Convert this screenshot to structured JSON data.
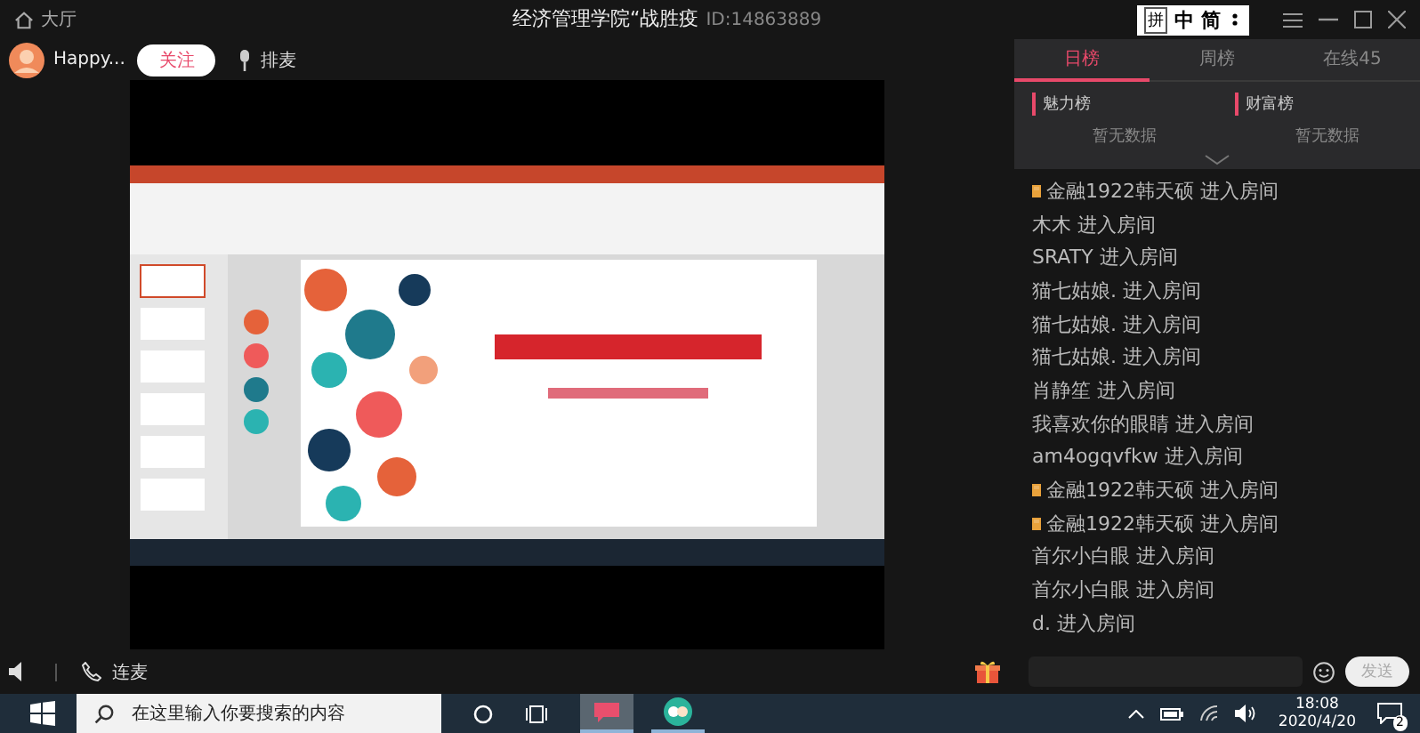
{
  "header": {
    "back_label": "大厅",
    "title": "经济管理学院“战胜疫",
    "room_id": "ID:14863889"
  },
  "ime_bar": [
    "拼",
    "中",
    "简"
  ],
  "host": {
    "name": "Happy...",
    "follow_button": "关注",
    "queue_label": "排麦"
  },
  "tabs": [
    {
      "label": "日榜",
      "selected": true
    },
    {
      "label": "周榜",
      "selected": false
    },
    {
      "label": "在线45",
      "selected": false
    }
  ],
  "rankings": [
    {
      "title": "魅力榜",
      "empty_text": "暂无数据"
    },
    {
      "title": "财富榜",
      "empty_text": "暂无数据"
    }
  ],
  "chat": [
    {
      "text": "金融1922韩天硕 进入房间",
      "badge": true
    },
    {
      "text": "木木 进入房间",
      "badge": false
    },
    {
      "text": "SRATY 进入房间",
      "badge": false
    },
    {
      "text": "猫七姑娘. 进入房间",
      "badge": false
    },
    {
      "text": "猫七姑娘. 进入房间",
      "badge": false
    },
    {
      "text": "猫七姑娘. 进入房间",
      "badge": false
    },
    {
      "text": "肖静笙 进入房间",
      "badge": false
    },
    {
      "text": "我喜欢你的眼睛 进入房间",
      "badge": false
    },
    {
      "text": "am4ogqvfkw 进入房间",
      "badge": false
    },
    {
      "text": "金融1922韩天硕 进入房间",
      "badge": true
    },
    {
      "text": "金融1922韩天硕 进入房间",
      "badge": true
    },
    {
      "text": "首尔小白眼 进入房间",
      "badge": false
    },
    {
      "text": "首尔小白眼 进入房间",
      "badge": false
    },
    {
      "text": "d. 进入房间",
      "badge": false
    }
  ],
  "controls": {
    "mic_label": "连麦",
    "send_button": "发送"
  },
  "taskbar": {
    "search_placeholder": "在这里输入你要搜索的内容",
    "time": "18:08",
    "date": "2020/4/20",
    "notifications": "2"
  }
}
